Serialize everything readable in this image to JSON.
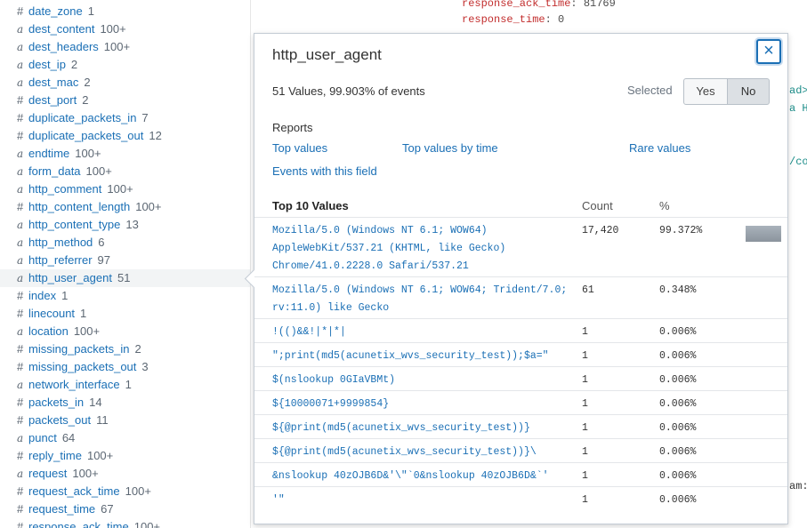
{
  "sidebar": {
    "fields": [
      {
        "type": "#",
        "name": "date_zone",
        "count": "1"
      },
      {
        "type": "a",
        "name": "dest_content",
        "count": "100+"
      },
      {
        "type": "a",
        "name": "dest_headers",
        "count": "100+"
      },
      {
        "type": "a",
        "name": "dest_ip",
        "count": "2"
      },
      {
        "type": "a",
        "name": "dest_mac",
        "count": "2"
      },
      {
        "type": "#",
        "name": "dest_port",
        "count": "2"
      },
      {
        "type": "#",
        "name": "duplicate_packets_in",
        "count": "7"
      },
      {
        "type": "#",
        "name": "duplicate_packets_out",
        "count": "12"
      },
      {
        "type": "a",
        "name": "endtime",
        "count": "100+"
      },
      {
        "type": "a",
        "name": "form_data",
        "count": "100+"
      },
      {
        "type": "a",
        "name": "http_comment",
        "count": "100+"
      },
      {
        "type": "#",
        "name": "http_content_length",
        "count": "100+"
      },
      {
        "type": "a",
        "name": "http_content_type",
        "count": "13"
      },
      {
        "type": "a",
        "name": "http_method",
        "count": "6"
      },
      {
        "type": "a",
        "name": "http_referrer",
        "count": "97"
      },
      {
        "type": "a",
        "name": "http_user_agent",
        "count": "51"
      },
      {
        "type": "#",
        "name": "index",
        "count": "1"
      },
      {
        "type": "#",
        "name": "linecount",
        "count": "1"
      },
      {
        "type": "a",
        "name": "location",
        "count": "100+"
      },
      {
        "type": "#",
        "name": "missing_packets_in",
        "count": "2"
      },
      {
        "type": "#",
        "name": "missing_packets_out",
        "count": "3"
      },
      {
        "type": "a",
        "name": "network_interface",
        "count": "1"
      },
      {
        "type": "#",
        "name": "packets_in",
        "count": "14"
      },
      {
        "type": "#",
        "name": "packets_out",
        "count": "11"
      },
      {
        "type": "a",
        "name": "punct",
        "count": "64"
      },
      {
        "type": "#",
        "name": "reply_time",
        "count": "100+"
      },
      {
        "type": "a",
        "name": "request",
        "count": "100+"
      },
      {
        "type": "#",
        "name": "request_ack_time",
        "count": "100+"
      },
      {
        "type": "#",
        "name": "request_time",
        "count": "67"
      },
      {
        "type": "#",
        "name": "response_ack_time",
        "count": "100+"
      }
    ],
    "selected_field": "http_user_agent"
  },
  "background_events": {
    "line1_key": "response_ack_time",
    "line1_value": ": 81769",
    "line2_key": "response_time",
    "line2_value": ": 0",
    "edge_fragments": [
      "ad>",
      "a HP",
      "/com",
      "am:I"
    ]
  },
  "popup": {
    "title": "http_user_agent",
    "close_label": "×",
    "summary": "51 Values, 99.903% of events",
    "selected_label": "Selected",
    "yes_label": "Yes",
    "no_label": "No",
    "selected_value": "No",
    "reports_heading": "Reports",
    "reports": {
      "top_values": "Top values",
      "top_values_by_time": "Top values by time",
      "rare_values": "Rare values",
      "events_with_field": "Events with this field"
    },
    "table": {
      "heading": "Top 10 Values",
      "count_header": "Count",
      "percent_header": "%",
      "rows": [
        {
          "value": "Mozilla/5.0 (Windows NT 6.1; WOW64) AppleWebKit/537.21 (KHTML, like Gecko) Chrome/41.0.2228.0 Safari/537.21",
          "count": "17,420",
          "percent": "99.372%",
          "fraction": 0.99372
        },
        {
          "value": "Mozilla/5.0 (Windows NT 6.1; WOW64; Trident/7.0; rv:11.0) like Gecko",
          "count": "61",
          "percent": "0.348%",
          "fraction": 0.00348
        },
        {
          "value": "!(()&&!|*|*|",
          "count": "1",
          "percent": "0.006%",
          "fraction": 6e-05
        },
        {
          "value": "\";print(md5(acunetix_wvs_security_test));$a=\"",
          "count": "1",
          "percent": "0.006%",
          "fraction": 6e-05
        },
        {
          "value": "$(nslookup 0GIaVBMt)",
          "count": "1",
          "percent": "0.006%",
          "fraction": 6e-05
        },
        {
          "value": "${10000071+9999854}",
          "count": "1",
          "percent": "0.006%",
          "fraction": 6e-05
        },
        {
          "value": "${@print(md5(acunetix_wvs_security_test))}",
          "count": "1",
          "percent": "0.006%",
          "fraction": 6e-05
        },
        {
          "value": "${@print(md5(acunetix_wvs_security_test))}\\",
          "count": "1",
          "percent": "0.006%",
          "fraction": 6e-05
        },
        {
          "value": "&nslookup 40zOJB6D&'\\\"`0&nslookup 40zOJB6D&`'",
          "count": "1",
          "percent": "0.006%",
          "fraction": 6e-05
        },
        {
          "value": "'\"",
          "count": "1",
          "percent": "0.006%",
          "fraction": 6e-05
        }
      ]
    }
  },
  "colors": {
    "link": "#1a6fb5",
    "event_key": "#c22d2d",
    "bar": "#98a1aa"
  }
}
